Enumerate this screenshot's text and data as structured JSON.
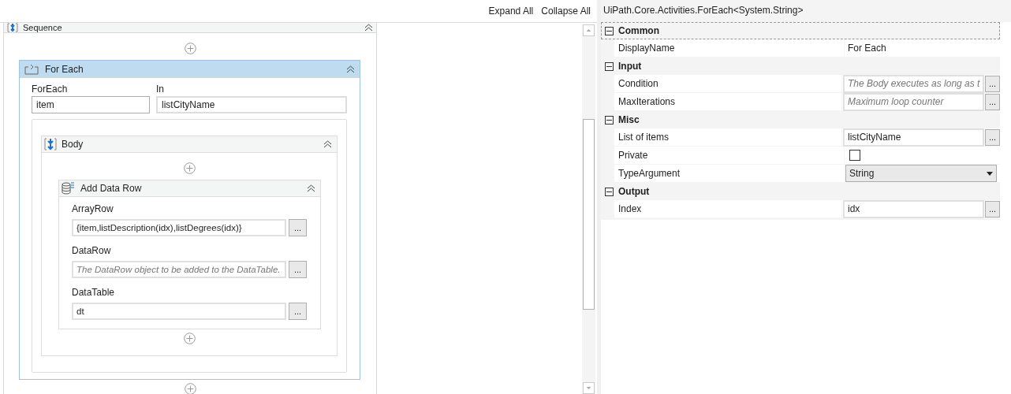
{
  "toolbar": {
    "buttons": [
      {
        "label": "Expand All"
      },
      {
        "label": "Collapse All"
      }
    ]
  },
  "designer": {
    "sequence": {
      "title": "Sequence"
    },
    "for_each": {
      "title": "For Each",
      "selected": true,
      "fields": [
        {
          "label": "ForEach",
          "value": "item"
        },
        {
          "label": "In",
          "value": "listCityName"
        }
      ],
      "body": {
        "title": "Body",
        "activity": {
          "title": "Add Data Row",
          "fields": [
            {
              "label": "ArrayRow",
              "value": "{item,listDescription(idx),listDegrees(idx)}",
              "button": "..."
            },
            {
              "label": "DataRow",
              "placeholder": "The DataRow object to be added to the DataTable.",
              "button": "..."
            },
            {
              "label": "DataTable",
              "value": "dt",
              "button": "..."
            }
          ]
        }
      }
    }
  },
  "properties": {
    "title": "UiPath.Core.Activities.ForEach<System.String>",
    "categories": [
      {
        "name": "Common",
        "expanded": true,
        "selected": true,
        "rows": [
          {
            "kind": "text",
            "label": "DisplayName",
            "value": "For Each"
          }
        ]
      },
      {
        "name": "Input",
        "expanded": true,
        "selected": false,
        "rows": [
          {
            "kind": "field",
            "label": "Condition",
            "placeholder": "The Body executes as long as t",
            "button": "..."
          },
          {
            "kind": "field",
            "label": "MaxIterations",
            "placeholder": "Maximum loop counter",
            "button": "..."
          }
        ]
      },
      {
        "name": "Misc",
        "expanded": true,
        "selected": false,
        "rows": [
          {
            "kind": "field",
            "label": "List of items",
            "value": "listCityName",
            "button": "..."
          },
          {
            "kind": "checkbox",
            "label": "Private",
            "checked": false
          },
          {
            "kind": "dropdown",
            "label": "TypeArgument",
            "value": "String"
          }
        ]
      },
      {
        "name": "Output",
        "expanded": true,
        "selected": false,
        "rows": [
          {
            "kind": "field",
            "label": "Index",
            "value": "idx",
            "button": "..."
          }
        ]
      }
    ]
  }
}
